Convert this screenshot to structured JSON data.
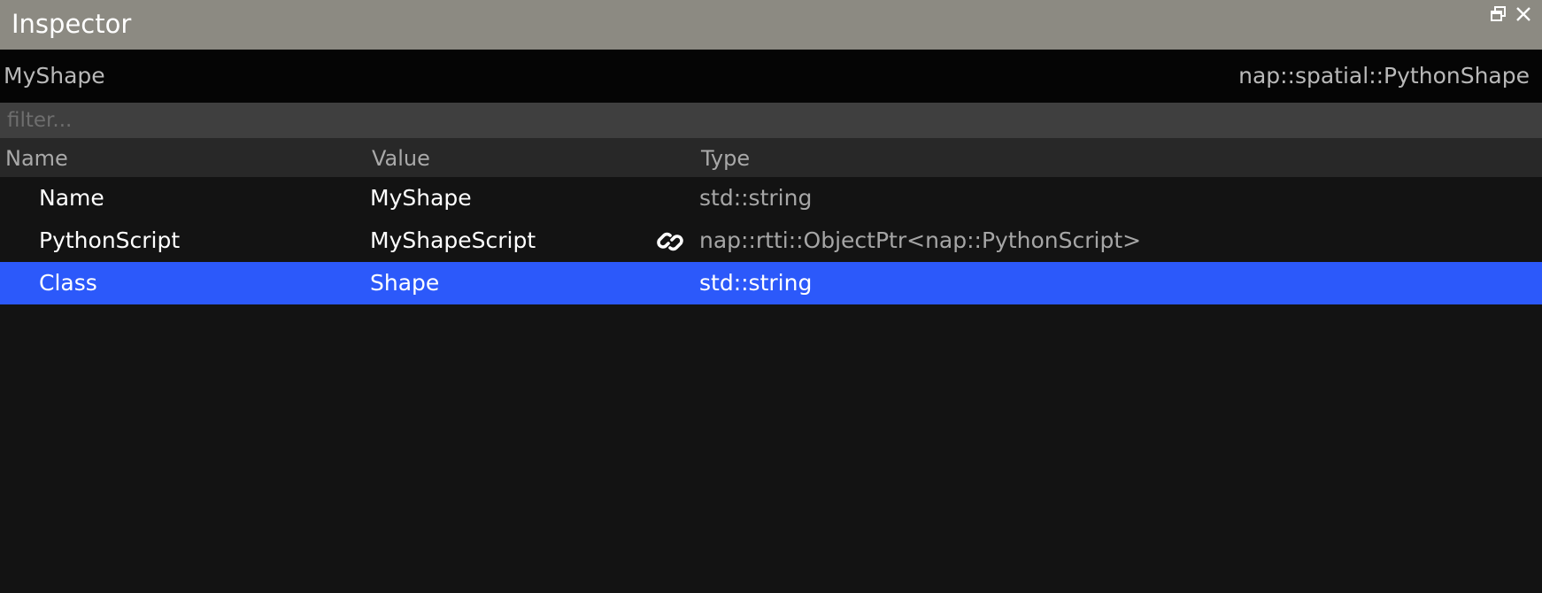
{
  "window": {
    "title": "Inspector",
    "icons": {
      "restore": "restore-window-icon",
      "close": "close-icon"
    }
  },
  "object": {
    "name": "MyShape",
    "type": "nap::spatial::PythonShape"
  },
  "filter": {
    "placeholder": "filter...",
    "value": ""
  },
  "columns": {
    "name": "Name",
    "value": "Value",
    "type": "Type"
  },
  "rows": [
    {
      "name": "Name",
      "value": "MyShape",
      "type": "std::string",
      "selected": false,
      "has_link": false
    },
    {
      "name": "PythonScript",
      "value": "MyShapeScript",
      "type": "nap::rtti::ObjectPtr<nap::PythonScript>",
      "selected": false,
      "has_link": true,
      "link_icon": "link-icon"
    },
    {
      "name": "Class",
      "value": "Shape",
      "type": "std::string",
      "selected": true,
      "has_link": false
    }
  ],
  "colors": {
    "titlebar": "#8c8a82",
    "selection": "#2c59fa",
    "background": "#131313"
  }
}
